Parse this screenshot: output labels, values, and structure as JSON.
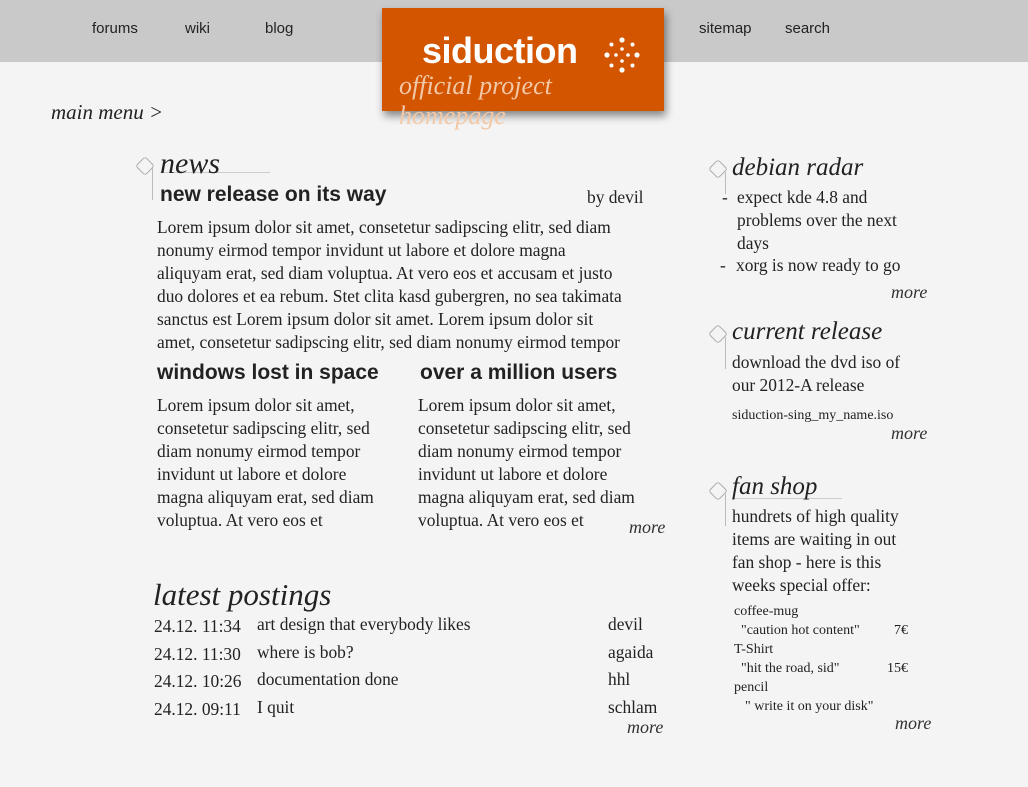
{
  "nav": {
    "forums": "forums",
    "wiki": "wiki",
    "blog": "blog",
    "sitemap": "sitemap",
    "search": "search"
  },
  "logo": {
    "word": "siduction",
    "subtitle": "official project homepage"
  },
  "main_menu": "main menu >",
  "news": {
    "title": "news",
    "lead": {
      "headline": "new release on its way",
      "author": "by devil",
      "lines": [
        "Lorem ipsum dolor sit amet, consetetur sadipscing elitr, sed diam",
        "nonumy eirmod tempor invidunt ut labore et dolore magna",
        "aliquyam erat, sed diam voluptua. At vero eos et accusam et justo",
        "duo dolores et ea rebum. Stet clita kasd gubergren, no sea takimata",
        "sanctus est Lorem ipsum dolor sit amet. Lorem ipsum dolor sit",
        "amet, consetetur sadipscing elitr, sed diam nonumy eirmod tempor"
      ]
    },
    "left": {
      "headline": "windows lost in space",
      "lines": [
        "Lorem ipsum dolor sit amet,",
        "consetetur sadipscing elitr, sed",
        "diam nonumy eirmod tempor",
        "invidunt ut labore et dolore",
        "magna aliquyam erat, sed diam",
        "voluptua. At vero eos et"
      ]
    },
    "right": {
      "headline": "over a million users",
      "lines": [
        "Lorem ipsum dolor sit amet,",
        "consetetur sadipscing elitr, sed",
        "diam nonumy eirmod tempor",
        "invidunt ut labore et dolore",
        "magna aliquyam erat, sed diam",
        "voluptua. At vero eos et"
      ]
    },
    "more": "more"
  },
  "postings": {
    "title": "latest postings",
    "rows": [
      {
        "date": "24.12. 11:34",
        "title": "art design that everybody likes",
        "author": "devil"
      },
      {
        "date": "24.12. 11:30",
        "title": "where is bob?",
        "author": "agaida"
      },
      {
        "date": "24.12. 10:26",
        "title": "documentation done",
        "author": "hhl"
      },
      {
        "date": "24.12. 09:11",
        "title": "I quit",
        "author": "schlam"
      }
    ],
    "more": "more"
  },
  "radar": {
    "title": "debian radar",
    "items": [
      {
        "bullet": "-",
        "lines": [
          "expect kde 4.8 and",
          "problems over the next",
          "days"
        ]
      },
      {
        "bullet": "-",
        "lines": [
          "xorg is now ready to go"
        ]
      }
    ],
    "more": "more"
  },
  "release": {
    "title": "current release",
    "lines": [
      "download the dvd iso of",
      "our 2012-A release"
    ],
    "file": "siduction-sing_my_name.iso",
    "more": "more"
  },
  "shop": {
    "title": "fan shop",
    "lines": [
      "hundrets of high quality",
      "items are waiting in out",
      "fan shop - here is this",
      "weeks special offer:"
    ],
    "offers": [
      {
        "item": "coffee-mug",
        "desc": "\"caution hot content\"",
        "price": "7€"
      },
      {
        "item": "T-Shirt",
        "desc": "\"hit the road, sid\"",
        "price": "15€"
      },
      {
        "item": "pencil",
        "desc": "\" write it on your disk\"",
        "price": ""
      }
    ],
    "more": "more"
  }
}
